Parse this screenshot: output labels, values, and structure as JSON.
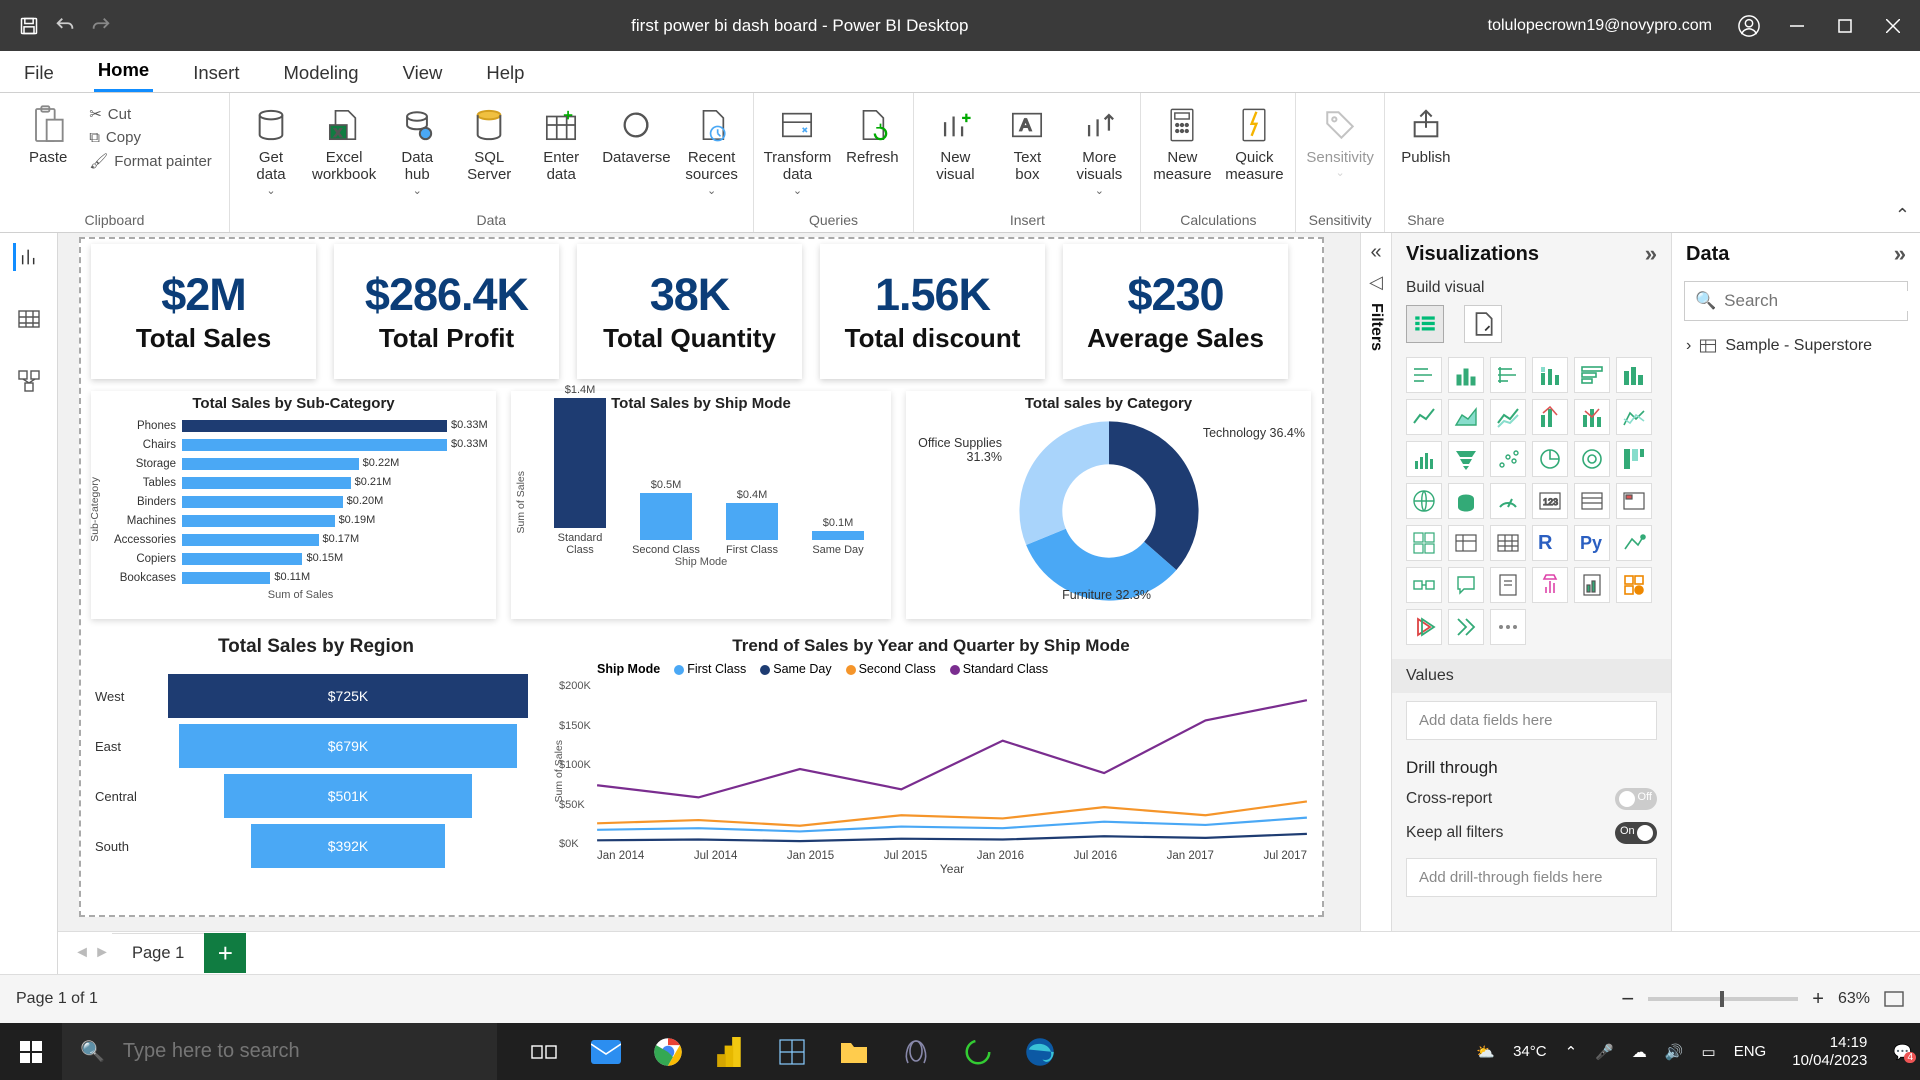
{
  "titlebar": {
    "title": "first power bi dash board - Power BI Desktop",
    "user_email": "tolulopecrown19@novypro.com"
  },
  "menutabs": [
    "File",
    "Home",
    "Insert",
    "Modeling",
    "View",
    "Help"
  ],
  "menutabs_active": "Home",
  "ribbon": {
    "clipboard": {
      "paste": "Paste",
      "cut": "Cut",
      "copy": "Copy",
      "format": "Format painter",
      "group": "Clipboard"
    },
    "data": {
      "getdata": "Get\ndata",
      "excel": "Excel\nworkbook",
      "datahub": "Data\nhub",
      "sql": "SQL\nServer",
      "enter": "Enter\ndata",
      "dataverse": "Dataverse",
      "recent": "Recent\nsources",
      "group": "Data"
    },
    "queries": {
      "transform": "Transform\ndata",
      "refresh": "Refresh",
      "group": "Queries"
    },
    "insert": {
      "newvisual": "New\nvisual",
      "textbox": "Text\nbox",
      "more": "More\nvisuals",
      "group": "Insert"
    },
    "calc": {
      "newmeasure": "New\nmeasure",
      "quick": "Quick\nmeasure",
      "group": "Calculations"
    },
    "sensitivity": {
      "label": "Sensitivity",
      "group": "Sensitivity"
    },
    "share": {
      "publish": "Publish",
      "group": "Share"
    }
  },
  "filters_label": "Filters",
  "viz_panel": {
    "title": "Visualizations",
    "build": "Build visual",
    "values_hdr": "Values",
    "values_placeholder": "Add data fields here",
    "drill_hdr": "Drill through",
    "cross": "Cross-report",
    "cross_state": "Off",
    "keep": "Keep all filters",
    "keep_state": "On",
    "drill_placeholder": "Add drill-through fields here"
  },
  "data_panel": {
    "title": "Data",
    "search_placeholder": "Search",
    "dataset": "Sample - Superstore"
  },
  "cards": [
    {
      "value": "$2M",
      "label": "Total Sales"
    },
    {
      "value": "$286.4K",
      "label": "Total Profit"
    },
    {
      "value": "38K",
      "label": "Total Quantity"
    },
    {
      "value": "1.56K",
      "label": "Total discount"
    },
    {
      "value": "$230",
      "label": "Average Sales"
    }
  ],
  "chart_data": [
    {
      "id": "subcat",
      "type": "bar",
      "orientation": "horizontal",
      "title": "Total Sales by Sub-Category",
      "xlabel": "Sum of Sales",
      "ylabel": "Sub-Category",
      "categories": [
        "Phones",
        "Chairs",
        "Storage",
        "Tables",
        "Binders",
        "Machines",
        "Accessories",
        "Copiers",
        "Bookcases"
      ],
      "values_label": [
        "$0.33M",
        "$0.33M",
        "$0.22M",
        "$0.21M",
        "$0.20M",
        "$0.19M",
        "$0.17M",
        "$0.15M",
        "$0.11M"
      ],
      "values": [
        0.33,
        0.33,
        0.22,
        0.21,
        0.2,
        0.19,
        0.17,
        0.15,
        0.11
      ],
      "highlight_index": 0,
      "highlight_color": "#1e3c72"
    },
    {
      "id": "shipmode",
      "type": "bar",
      "orientation": "vertical",
      "title": "Total Sales by Ship Mode",
      "xlabel": "Ship Mode",
      "ylabel": "Sum of Sales",
      "categories": [
        "Standard Class",
        "Second Class",
        "First Class",
        "Same Day"
      ],
      "values_label": [
        "$1.4M",
        "$0.5M",
        "$0.4M",
        "$0.1M"
      ],
      "values": [
        1.4,
        0.5,
        0.4,
        0.1
      ],
      "highlight_index": 0,
      "highlight_color": "#1e3c72"
    },
    {
      "id": "category",
      "type": "pie",
      "title": "Total sales by Category",
      "slices": [
        {
          "name": "Technology",
          "pct": 36.4,
          "color": "#1e3c72"
        },
        {
          "name": "Furniture",
          "pct": 32.3,
          "color": "#4aa8f5"
        },
        {
          "name": "Office Supplies",
          "pct": 31.3,
          "color": "#a9d4fb"
        }
      ],
      "labels": [
        "Technology 36.4%",
        "Furniture 32.3%",
        "Office Supplies 31.3%"
      ]
    },
    {
      "id": "region",
      "type": "bar",
      "subtype": "funnel",
      "title": "Total Sales by Region",
      "categories": [
        "West",
        "East",
        "Central",
        "South"
      ],
      "values_label": [
        "$725K",
        "$679K",
        "$501K",
        "$392K"
      ],
      "values": [
        725,
        679,
        501,
        392
      ],
      "highlight_index": 0,
      "highlight_color": "#1e3c72",
      "bar_color": "#4aa8f5"
    },
    {
      "id": "trend",
      "type": "line",
      "title": "Trend of Sales by Year and Quarter by Ship Mode",
      "xlabel": "Year",
      "ylabel": "Sum of Sales",
      "legend_title": "Ship Mode",
      "x": [
        "Jan 2014",
        "Jul 2014",
        "Jan 2015",
        "Jul 2015",
        "Jan 2016",
        "Jul 2016",
        "Jan 2017",
        "Jul 2017"
      ],
      "ylim": [
        0,
        200000
      ],
      "yticks": [
        "$0K",
        "$50K",
        "$100K",
        "$150K",
        "$200K"
      ],
      "series": [
        {
          "name": "First Class",
          "color": "#4aa8f5",
          "values": [
            20,
            22,
            18,
            24,
            22,
            30,
            26,
            35
          ]
        },
        {
          "name": "Same Day",
          "color": "#1e3c72",
          "values": [
            7,
            8,
            6,
            9,
            8,
            12,
            10,
            15
          ]
        },
        {
          "name": "Second Class",
          "color": "#f5952a",
          "values": [
            28,
            32,
            25,
            38,
            34,
            48,
            38,
            55
          ]
        },
        {
          "name": "Standard Class",
          "color": "#7a2d8f",
          "values": [
            75,
            60,
            95,
            70,
            130,
            90,
            155,
            180
          ]
        }
      ],
      "series_unit": "K"
    }
  ],
  "pagetabs": {
    "page": "Page 1"
  },
  "statusbar": {
    "text": "Page 1 of 1",
    "zoom": "63%"
  },
  "taskbar": {
    "search_placeholder": "Type here to search",
    "weather": "34°C",
    "lang": "ENG",
    "time": "14:19",
    "date": "10/04/2023",
    "notif": "4"
  }
}
